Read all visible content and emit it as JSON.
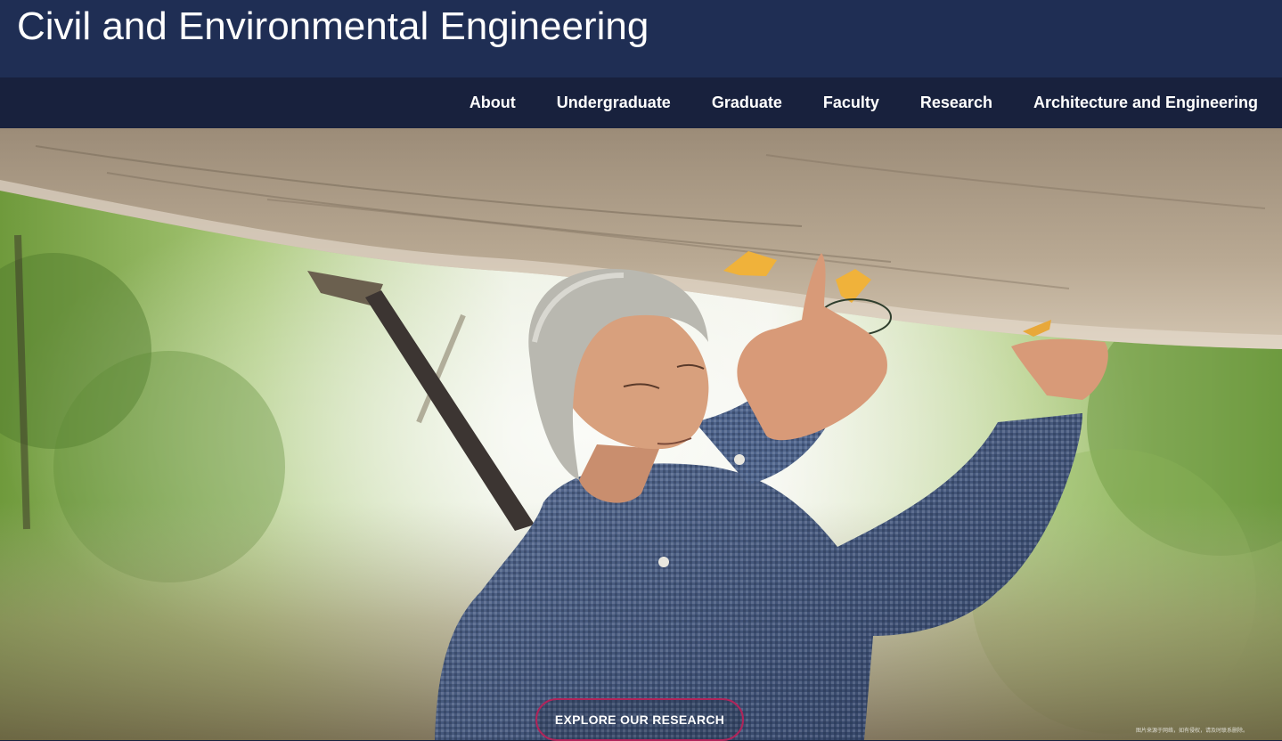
{
  "header": {
    "site_title": "Civil and Environmental Engineering"
  },
  "nav": {
    "items": [
      {
        "label": "About"
      },
      {
        "label": "Undergraduate"
      },
      {
        "label": "Graduate"
      },
      {
        "label": "Faculty"
      },
      {
        "label": "Research"
      },
      {
        "label": "Architecture and Engineering"
      }
    ]
  },
  "hero": {
    "cta_label": "EXPLORE OUR RESEARCH",
    "watermark": "图片来源于网络，如有侵权，请及时联系删除。"
  },
  "colors": {
    "header_bg": "#1f2e54",
    "nav_bg": "#18213d",
    "cta_border": "#b0245a",
    "text": "#ffffff"
  }
}
